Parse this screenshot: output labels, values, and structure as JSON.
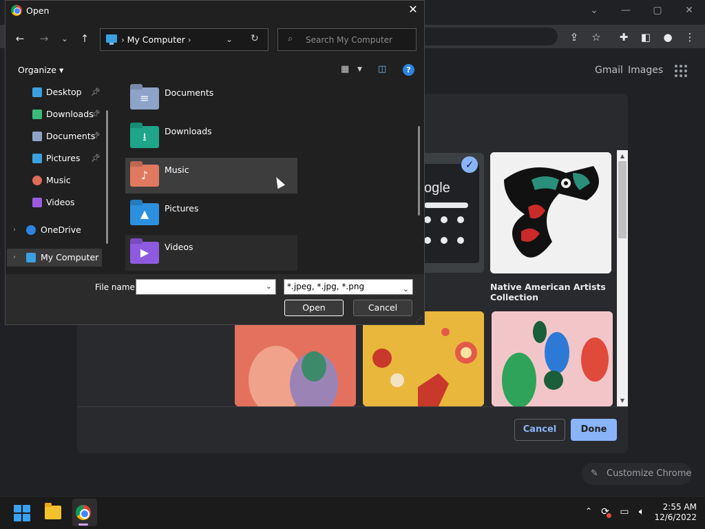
{
  "window": {
    "controls": {
      "minimize": "—",
      "maximize": "▢",
      "close": "✕",
      "tab_search": "⌄"
    },
    "toolbar_icons": [
      "share-icon",
      "star-icon",
      "extensions-icon",
      "sidepanel-icon",
      "profile-icon",
      "menu-icon"
    ]
  },
  "newtab": {
    "gmail": "Gmail",
    "images": "Images"
  },
  "customize_modal": {
    "selected_tile_text": "ogle",
    "tile_caption": "Native American Artists Collection",
    "cancel_label": "Cancel",
    "done_label": "Done",
    "customize_chrome": "Customize Chrome"
  },
  "dialog": {
    "title": "Open",
    "close": "✕",
    "address_location": "My Computer",
    "search_placeholder": "Search My Computer",
    "organize_label": "Organize ▾",
    "help": "?",
    "sidebar": [
      {
        "label": "Desktop",
        "pinned": true,
        "icon": "desktop-icon",
        "color": "#3aa0e0"
      },
      {
        "label": "Downloads",
        "pinned": true,
        "icon": "downloads-icon",
        "color": "#3cba7a"
      },
      {
        "label": "Documents",
        "pinned": true,
        "icon": "documents-icon",
        "color": "#8da3c8"
      },
      {
        "label": "Pictures",
        "pinned": true,
        "icon": "pictures-icon",
        "color": "#3aa0e0"
      },
      {
        "label": "Music",
        "pinned": false,
        "icon": "music-icon",
        "color": "#e06c5a"
      },
      {
        "label": "Videos",
        "pinned": false,
        "icon": "videos-icon",
        "color": "#9b59e0"
      },
      {
        "label": "OneDrive",
        "pinned": false,
        "icon": "onedrive-icon",
        "color": "#2d84e0"
      },
      {
        "label": "My Computer",
        "pinned": false,
        "icon": "computer-icon",
        "color": "#3aa0e0"
      }
    ],
    "files": [
      {
        "name": "Documents",
        "color": "#8da3c8",
        "icon": "documents-folder-icon",
        "glyph": "≡"
      },
      {
        "name": "Downloads",
        "color": "#1fa58a",
        "icon": "downloads-folder-icon",
        "glyph": "⭳"
      },
      {
        "name": "Music",
        "color": "#e0795f",
        "icon": "music-folder-icon",
        "glyph": "♪"
      },
      {
        "name": "Pictures",
        "color": "#2d8fe0",
        "icon": "pictures-folder-icon",
        "glyph": "▲"
      },
      {
        "name": "Videos",
        "color": "#8e5ae0",
        "icon": "videos-folder-icon",
        "glyph": "▶"
      }
    ],
    "file_name_label": "File name:",
    "file_name_value": "",
    "file_type": "*.jpeg, *.jpg, *.png",
    "open_label": "Open",
    "cancel_label": "Cancel"
  },
  "taskbar": {
    "time": "2:55 AM",
    "date": "12/6/2022"
  }
}
